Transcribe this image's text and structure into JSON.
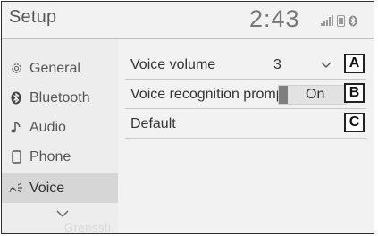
{
  "header": {
    "title": "Setup",
    "clock": "2:43",
    "status_icons": [
      "signal-icon",
      "phone-battery-icon",
      "bluetooth-icon"
    ]
  },
  "sidebar": {
    "items": [
      {
        "label": "General",
        "icon": "gear-icon",
        "selected": false
      },
      {
        "label": "Bluetooth",
        "icon": "bluetooth-icon",
        "selected": false
      },
      {
        "label": "Audio",
        "icon": "music-note-icon",
        "selected": false
      },
      {
        "label": "Phone",
        "icon": "phone-icon",
        "selected": false
      },
      {
        "label": "Voice",
        "icon": "voice-icon",
        "selected": true
      }
    ],
    "scroll_icon": "chevron-down-icon",
    "background_map_text": "Grenssti"
  },
  "main": {
    "rows": [
      {
        "label": "Voice volume",
        "value": "3",
        "control": "dropdown"
      },
      {
        "label": "Voice recognition prompts",
        "value": "On",
        "control": "toggle"
      },
      {
        "label": "Default",
        "control": "button"
      }
    ]
  },
  "annotations": [
    "A",
    "B",
    "C"
  ],
  "colors": {
    "header_bg": "#f2f2f2",
    "sidebar_bg": "#ededed",
    "selected_bg": "#d6d6d6",
    "toggle_bar": "#7f7f7f"
  }
}
